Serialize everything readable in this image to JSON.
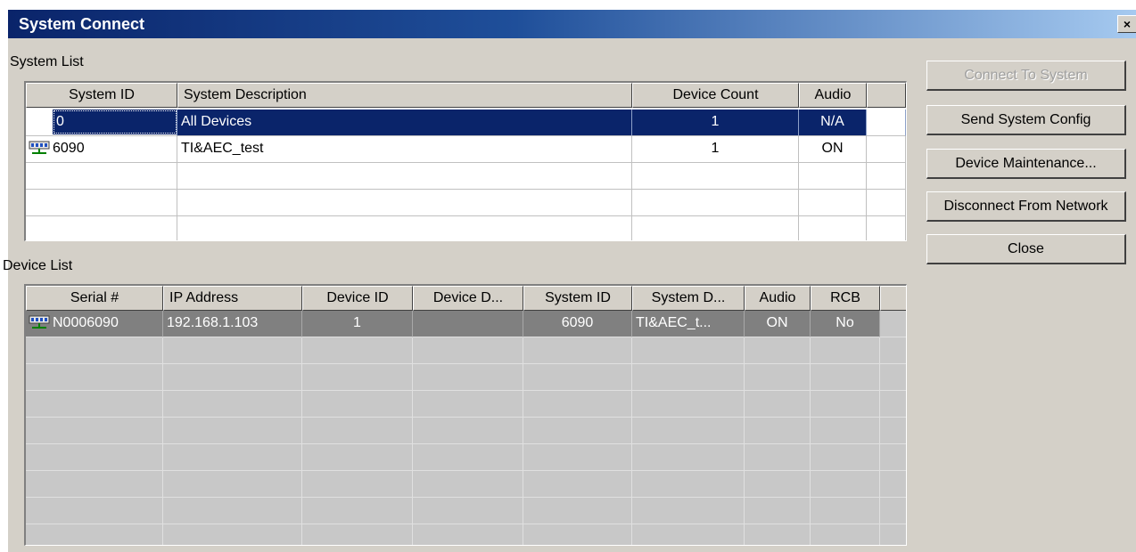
{
  "window": {
    "title": "System Connect",
    "close_glyph": "×"
  },
  "system_list": {
    "label": "System List",
    "columns": [
      "System ID",
      "System Description",
      "Device Count",
      "Audio"
    ],
    "rows": [
      {
        "id": "0",
        "description": "All Devices",
        "count": "1",
        "audio": "N/A",
        "icon": ""
      },
      {
        "id": "6090",
        "description": "TI&AEC_test",
        "count": "1",
        "audio": "ON",
        "icon": "network-device-icon"
      }
    ]
  },
  "device_list": {
    "label": "Device List",
    "columns": [
      "Serial #",
      "IP Address",
      "Device ID",
      "Device D...",
      "System ID",
      "System D...",
      "Audio",
      "RCB"
    ],
    "rows": [
      {
        "serial": "N0006090",
        "ip": "192.168.1.103",
        "device_id": "1",
        "device_desc": "",
        "system_id": "6090",
        "system_desc": "TI&AEC_t...",
        "audio": "ON",
        "rcb": "No",
        "icon": "network-device-icon"
      }
    ]
  },
  "buttons": {
    "connect": "Connect To System",
    "send_config": "Send System Config",
    "maintenance": "Device Maintenance...",
    "disconnect": "Disconnect From Network",
    "close": "Close"
  },
  "colors": {
    "selection": "#0a246a",
    "face": "#d4d0c8",
    "device_selection": "#808080"
  }
}
